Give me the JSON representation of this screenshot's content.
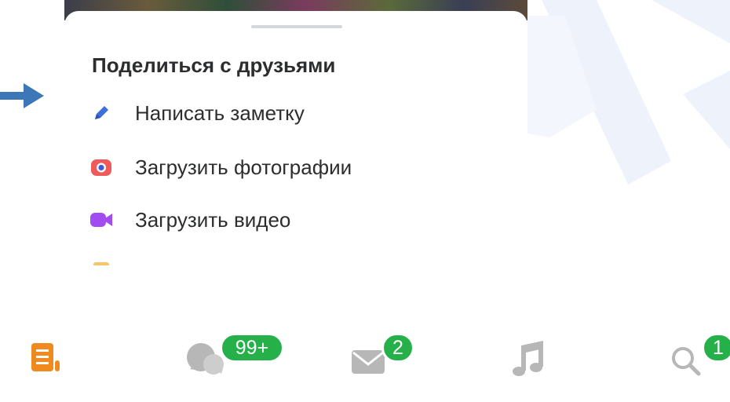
{
  "share_sheet": {
    "title": "Поделиться с друзьями",
    "items": [
      {
        "label": "Написать заметку",
        "icon": "pencil-icon",
        "color": "#3f6fd8"
      },
      {
        "label": "Загрузить фотографии",
        "icon": "camera-icon",
        "color": "#ef5a5a"
      },
      {
        "label": "Загрузить видео",
        "icon": "video-camera-icon",
        "color": "#a24bf0"
      }
    ]
  },
  "annotation": {
    "icon": "arrow-right-icon",
    "color": "#3d77b8"
  },
  "tabbar": {
    "items": [
      {
        "name": "feed",
        "icon": "feed-icon",
        "badge": "",
        "color": "#f08a1e"
      },
      {
        "name": "discussions",
        "icon": "chat-bubbles-icon",
        "badge": "99+",
        "color": "#b7b7b7"
      },
      {
        "name": "messages",
        "icon": "envelope-icon",
        "badge": "2",
        "color": "#b7b7b7"
      },
      {
        "name": "music",
        "icon": "music-note-icon",
        "badge": "",
        "color": "#b7b7b7"
      },
      {
        "name": "search",
        "icon": "search-icon",
        "badge": "1",
        "color": "#b7b7b7"
      }
    ],
    "badge_color": "#26b04a"
  }
}
